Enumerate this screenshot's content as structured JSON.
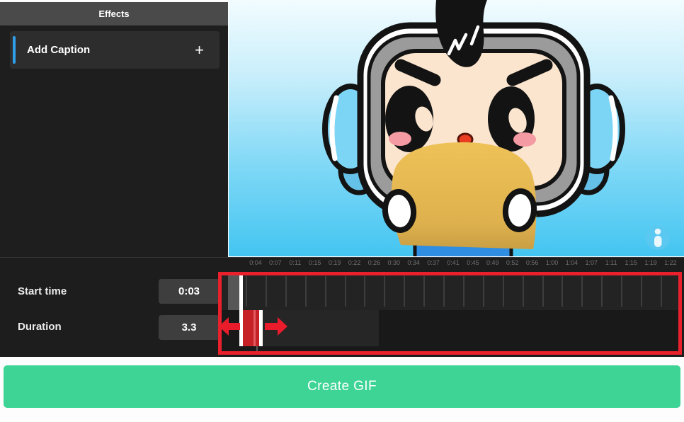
{
  "sidebar": {
    "header_title": "Effects",
    "add_caption": {
      "label": "Add Caption",
      "plus_icon": "+",
      "accent_color": "#2e9fe8"
    }
  },
  "preview": {
    "description": "cartoon character with headphones holding a blank tan sign",
    "info_icon": "i"
  },
  "controls": {
    "start_time": {
      "label": "Start time",
      "value": "0:03"
    },
    "duration": {
      "label": "Duration",
      "value": "3.3"
    }
  },
  "timeline": {
    "labels": [
      "0:04",
      "0:07",
      "0:11",
      "0:15",
      "0:19",
      "0:22",
      "0:26",
      "0:30",
      "0:34",
      "0:37",
      "0:41",
      "0:45",
      "0:49",
      "0:52",
      "0:56",
      "1:00",
      "1:04",
      "1:07",
      "1:11",
      "1:15",
      "1:19",
      "1:22"
    ],
    "annotation_color": "#e8212d",
    "selection_color": "#c52127",
    "playhead_color": "#ffffff"
  },
  "footer": {
    "create_gif_label": "Create GIF",
    "button_color": "#3ed496"
  }
}
